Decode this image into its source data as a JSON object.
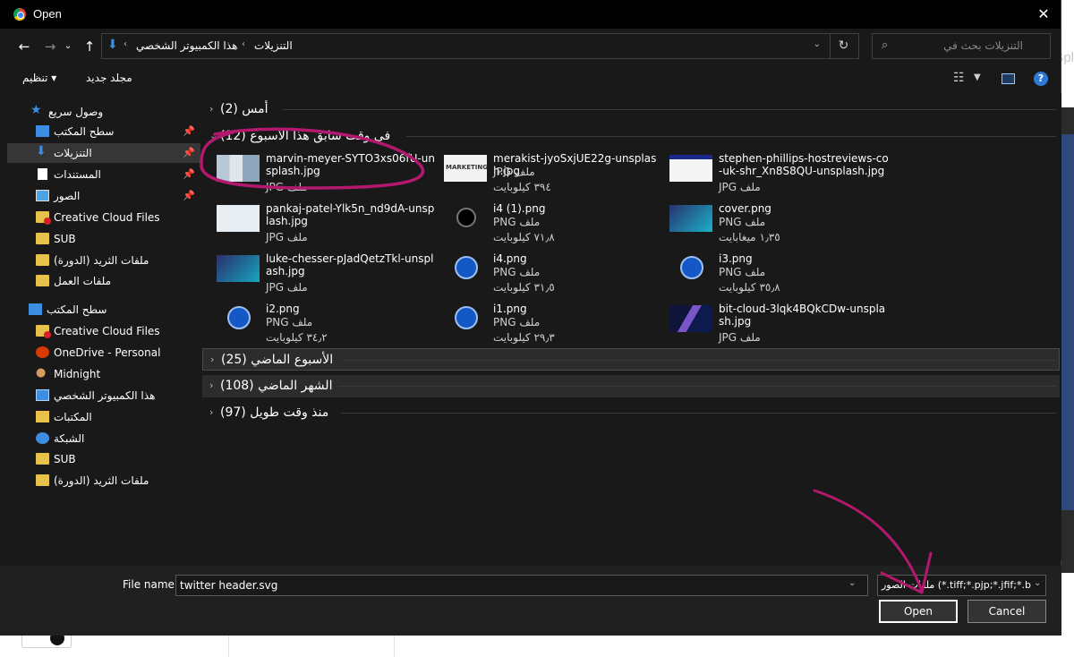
{
  "window": {
    "title": "Open",
    "close_glyph": "✕"
  },
  "nav": {
    "back": "←",
    "forward": "→",
    "dropdown": "⌄",
    "up": "↑"
  },
  "address": {
    "crumbs": [
      "هذا الكمبيوتر الشخصي",
      "التنزيلات"
    ],
    "refresh_glyph": "↻",
    "dropdown_glyph": "⌄"
  },
  "search": {
    "placeholder": "التنزيلات بحث في"
  },
  "toolbar": {
    "organize_label": "تنظيم ▾",
    "new_folder_label": "مجلد جديد",
    "help_glyph": "?"
  },
  "sidebar": {
    "items": [
      {
        "label": "وصول سريع",
        "icon": "star-icon"
      },
      {
        "label": "سطح المكتب",
        "icon": "desktop-icon",
        "pinned": true
      },
      {
        "label": "التنزيلات",
        "icon": "download-icon",
        "pinned": true,
        "selected": true
      },
      {
        "label": "المستندات",
        "icon": "document-icon",
        "pinned": true
      },
      {
        "label": "الصور",
        "icon": "pictures-icon",
        "pinned": true
      },
      {
        "label": "Creative Cloud Files",
        "icon": "creative-cloud-icon"
      },
      {
        "label": "SUB",
        "icon": "folder-icon"
      },
      {
        "label": "ملفات الثريد (الدورة)",
        "icon": "folder-icon"
      },
      {
        "label": "ملفات العمل",
        "icon": "folder-icon"
      },
      {
        "label": "سطح المكتب",
        "icon": "desktop-icon"
      },
      {
        "label": "Creative Cloud Files",
        "icon": "creative-cloud-icon"
      },
      {
        "label": "OneDrive - Personal",
        "icon": "onedrive-icon"
      },
      {
        "label": "Midnight",
        "icon": "user-icon"
      },
      {
        "label": "هذا الكمبيوتر الشخصي",
        "icon": "computer-icon"
      },
      {
        "label": "المكتبات",
        "icon": "libraries-icon"
      },
      {
        "label": "الشبكة",
        "icon": "network-icon"
      },
      {
        "label": "SUB",
        "icon": "folder-icon"
      },
      {
        "label": "ملفات الثريد (الدورة)",
        "icon": "folder-icon"
      }
    ]
  },
  "groups": [
    {
      "label": "(2) أمس"
    },
    {
      "label": "(12) في وقت سابق هذا الأسبوع"
    },
    {
      "label": "(25) الأسبوع الماضي"
    },
    {
      "label": "(108) الشهر الماضي"
    },
    {
      "label": "(97) منذ وقت طويل"
    }
  ],
  "files": [
    {
      "name": "marvin-meyer-SYTO3xs06fU-unsplash.jpg",
      "type": "JPG ملف",
      "size": "",
      "thumb": "photo"
    },
    {
      "name": "merakist-jyoSxjUE22g-unsplash.jpg",
      "type": "JPG ملف",
      "size": "٣٩٤ كيلوبايت",
      "thumb": "marketing"
    },
    {
      "name": "stephen-phillips-hostreviews-co-uk-shr_Xn8S8QU-unsplash.jpg",
      "type": "JPG ملف",
      "size": "",
      "thumb": "hosting"
    },
    {
      "name": "pankaj-patel-Ylk5n_nd9dA-unsplash.jpg",
      "type": "JPG ملف",
      "size": "",
      "thumb": "pankaj"
    },
    {
      "name": "i4 (1).png",
      "type": "PNG ملف",
      "size": "٧١٫٨ كيلوبايت",
      "thumb": "circle"
    },
    {
      "name": "cover.png",
      "type": "PNG ملف",
      "size": "١٫٣٥ ميغابايت",
      "thumb": "gradient"
    },
    {
      "name": "luke-chesser-pJadQetzTkl-unsplash.jpg",
      "type": "JPG ملف",
      "size": "",
      "thumb": "gradient2"
    },
    {
      "name": "i4.png",
      "type": "PNG ملف",
      "size": "٣١٫٥ كيلوبايت",
      "thumb": "badge"
    },
    {
      "name": "i3.png",
      "type": "PNG ملف",
      "size": "٣٥٫٨ كيلوبايت",
      "thumb": "badge"
    },
    {
      "name": "i2.png",
      "type": "PNG ملف",
      "size": "٣٤٫٢ كيلوبايت",
      "thumb": "badge"
    },
    {
      "name": "i1.png",
      "type": "PNG ملف",
      "size": "٢٩٫٣ كيلوبايت",
      "thumb": "badge"
    },
    {
      "name": "bit-cloud-3lqk4BQkCDw-unsplash.jpg",
      "type": "JPG ملف",
      "size": "",
      "thumb": "city"
    }
  ],
  "bottom": {
    "filename_label": "File name:",
    "filename_value": "twitter header.svg",
    "filter_value": "ملفات الصور (*.tiff;*.pjp;*.jfif;*.b",
    "open_label": "Open",
    "cancel_label": "Cancel"
  },
  "background_page": {
    "partial_text": "Spl"
  },
  "colors": {
    "annotation": "#b3186f",
    "accent": "#3d8ee0",
    "dialog_bg": "#191919"
  }
}
